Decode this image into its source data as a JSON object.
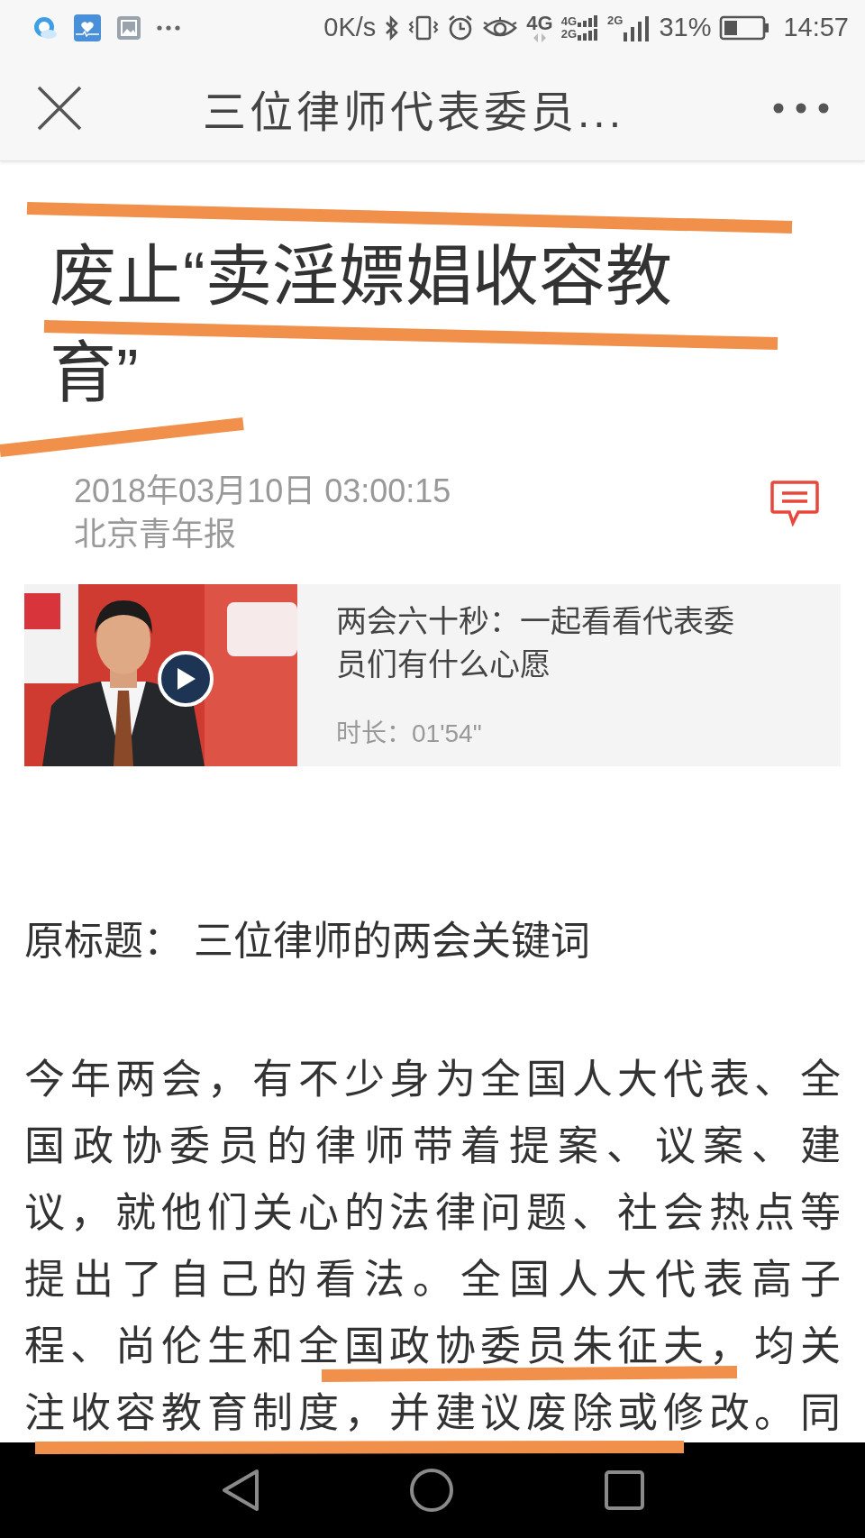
{
  "status_bar": {
    "net_speed": "0K/s",
    "data_type": "4G",
    "sim_1": [
      "4G",
      "2G"
    ],
    "sim_2": "2G",
    "battery": "31%",
    "time": "14:57"
  },
  "header": {
    "title": "三位律师代表委员..."
  },
  "article": {
    "title_lines": [
      "废止“卖淫嫖娼收容教",
      "育”"
    ],
    "date": "2018年03月10日 03:00:15",
    "source": "北京青年报",
    "video": {
      "kind": "picture",
      "title": "两会六十秒：一起看看代表委员们有什么心愿",
      "duration": "时长：01'54\""
    },
    "original_title": "原标题： 三位律师的两会关键词",
    "body_lines": [
      "今年两会，有不少身为全国人大代表、全",
      "国政协委员的律师带着提案、议案、建",
      "议，就他们关心的法律问题、社会热点等",
      "提出了自己的看法。全国人大代表高子",
      "程、尚伦生和全国政协委员朱征夫，均关",
      "注收容教育制度，并建议废除或修改。同"
    ]
  }
}
